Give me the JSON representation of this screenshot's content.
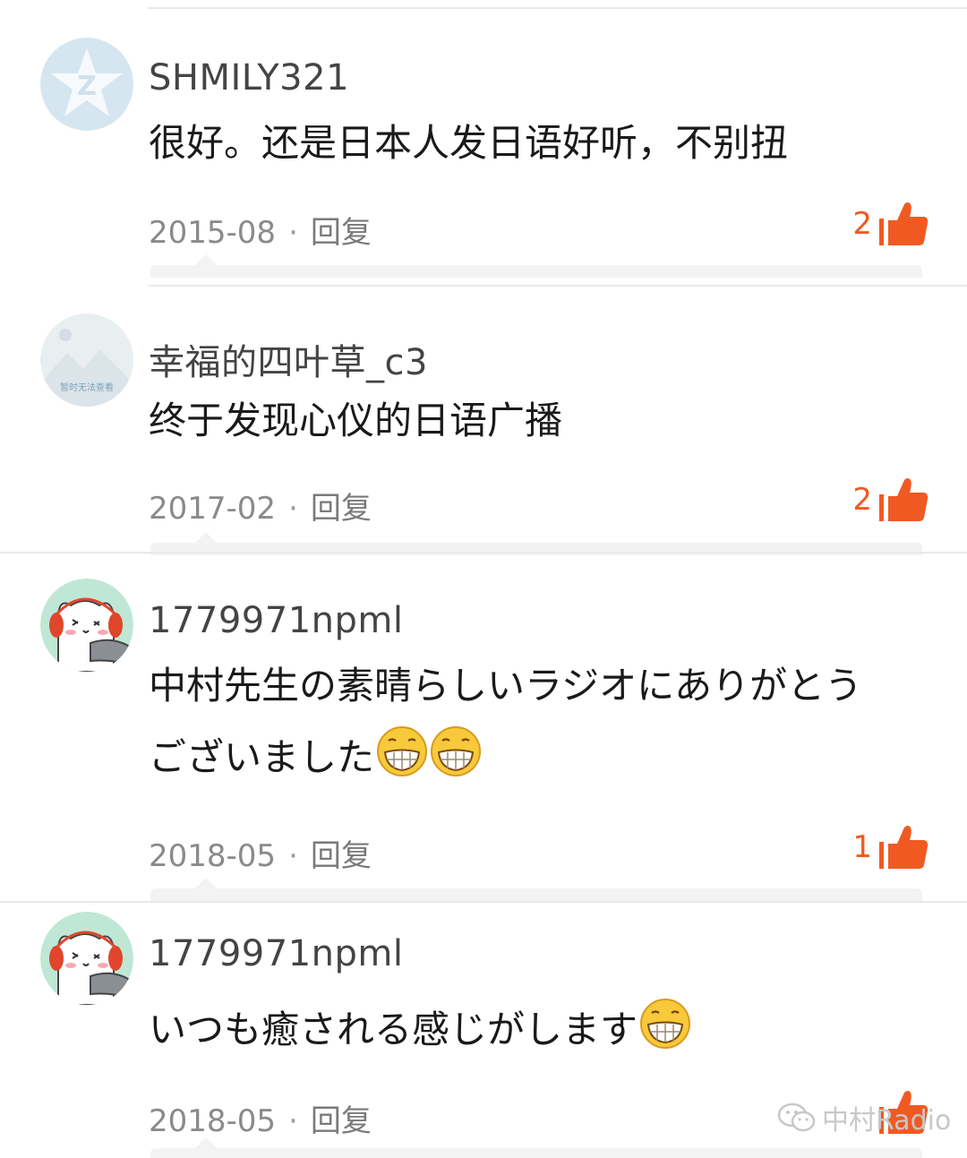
{
  "comments": [
    {
      "username": "SHMILY321",
      "avatar_icon": "qq-default-avatar-icon",
      "lines": [
        "很好。还是日本人发日语好听，不别扭"
      ],
      "date": "2015-08",
      "separator": "·",
      "reply_label": "回复",
      "likes": "2"
    },
    {
      "username": "幸福的四叶草_c3",
      "avatar_icon": "image-unavailable-avatar-icon",
      "avatar_text": "暂时无法查看",
      "lines": [
        "终于发现心仪的日语广播"
      ],
      "date": "2017-02",
      "separator": "·",
      "reply_label": "回复",
      "likes": "2"
    },
    {
      "username": "1779971npml",
      "avatar_icon": "cat-headphones-avatar-icon",
      "lines": [
        "中村先生の素晴らしいラジオにありがとう",
        "ございました"
      ],
      "emoji_count": 2,
      "date": "2018-05",
      "separator": "·",
      "reply_label": "回复",
      "likes": "1"
    },
    {
      "username": "1779971npml",
      "avatar_icon": "cat-headphones-avatar-icon",
      "lines": [
        "いつも癒される感じがします"
      ],
      "emoji_count": 1,
      "date": "2018-05",
      "separator": "·",
      "reply_label": "回复",
      "likes": ""
    }
  ],
  "watermark": {
    "text": "中村Radio",
    "icon": "wechat-icon"
  },
  "colors": {
    "like_accent": "#f05a22",
    "meta_text": "#8a8a8a",
    "divider": "#e9e9e9"
  }
}
